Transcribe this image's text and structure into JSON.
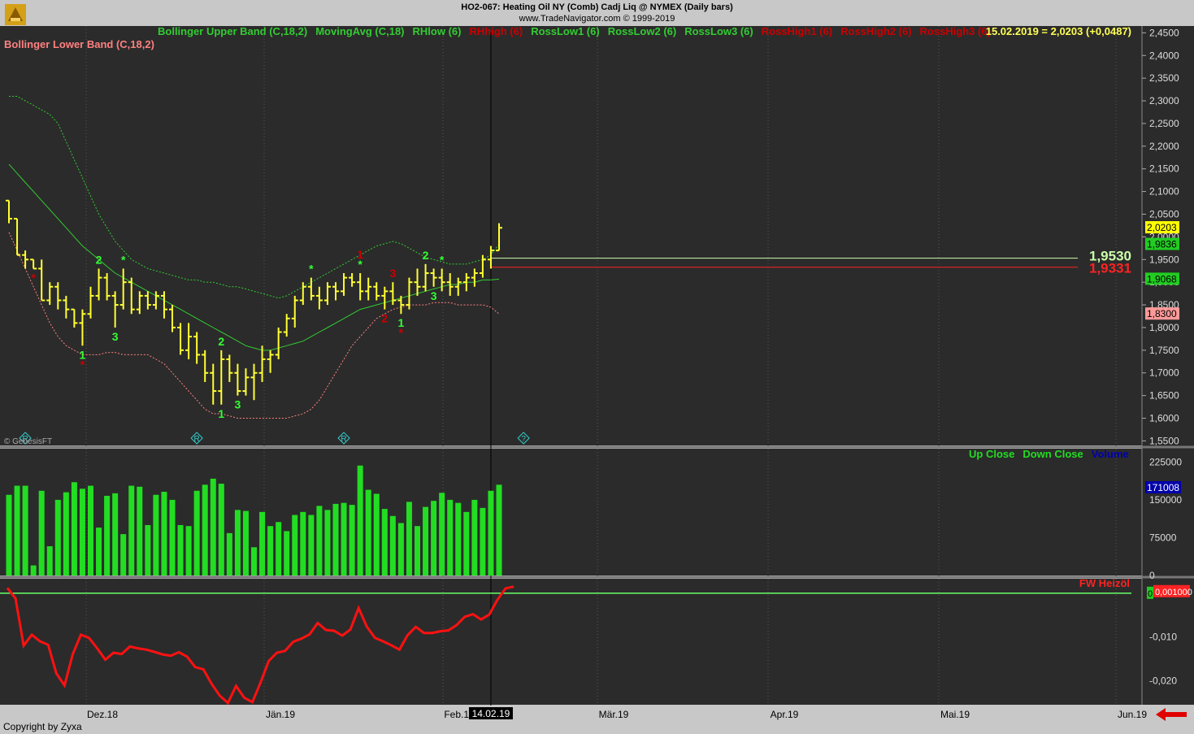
{
  "header": {
    "title": "HO2-067:  Heating Oil NY (Comb) Cadj Liq @ NYMEX  (Daily bars)",
    "subtitle": "www.TradeNavigator.com © 1999-2019"
  },
  "footer": {
    "copyright": "Copyright by Zyxa",
    "genesis": "© GenesisFT"
  },
  "colors": {
    "background": "#2b2b2b",
    "bars": "#ffff33",
    "bands": "#33cc33",
    "lower_band": "#ff8080",
    "volume": "#22dd22",
    "oscillator": "#ff1111",
    "ross_high": "#cc0000",
    "ross_low": "#33ff33"
  },
  "price_panel": {
    "legend": [
      {
        "text": "Bollinger Upper Band (C,18,2)",
        "color": "#33cc33"
      },
      {
        "text": "MovingAvg (C,18)",
        "color": "#33cc33"
      },
      {
        "text": "RHlow (6)",
        "color": "#33cc33"
      },
      {
        "text": "RHhigh (6)",
        "color": "#cc0000"
      },
      {
        "text": "RossLow1 (6)",
        "color": "#33cc33"
      },
      {
        "text": "RossLow2 (6)",
        "color": "#33cc33"
      },
      {
        "text": "RossLow3 (6)",
        "color": "#33cc33"
      },
      {
        "text": "RossHigh1 (6)",
        "color": "#cc0000"
      },
      {
        "text": "RossHigh2 (6)",
        "color": "#cc0000"
      },
      {
        "text": "RossHigh3 (6)",
        "color": "#cc0000"
      }
    ],
    "legend2": {
      "text": "Bollinger Lower Band (C,18,2)",
      "color": "#ff8080"
    },
    "last_quote": "15.02.2019 = 2,0203 (+0,0487)",
    "y_ticks": [
      "2,4500",
      "2,4000",
      "2,3500",
      "2,3000",
      "2,2500",
      "2,2000",
      "2,1500",
      "2,1000",
      "2,0500",
      "2,0000",
      "1,9500",
      "1,9000",
      "1,8500",
      "1,8000",
      "1,7500",
      "1,7000",
      "1,6500",
      "1,6000",
      "1,5500"
    ],
    "level_lines": [
      {
        "label": "1,9530",
        "value": 1.953,
        "color": "#ccffaa"
      },
      {
        "label": "1,9331",
        "value": 1.9331,
        "color": "#ff2222"
      }
    ],
    "value_tags": [
      {
        "label": "2,0203",
        "value": 2.0203,
        "bg": "#ffff00",
        "fg": "#000000"
      },
      {
        "label": "1,9836",
        "value": 1.9836,
        "bg": "#22cc22",
        "fg": "#000000"
      },
      {
        "label": "1,9068",
        "value": 1.9068,
        "bg": "#22cc22",
        "fg": "#000000"
      },
      {
        "label": "1,8300",
        "value": 1.83,
        "bg": "#ff9999",
        "fg": "#000000"
      }
    ],
    "markers": [
      {
        "i": 3,
        "t": "*",
        "c": "r",
        "low": true
      },
      {
        "i": 9,
        "t": "1",
        "c": "g",
        "low": true
      },
      {
        "i": 9,
        "t": "*",
        "c": "r",
        "low": true,
        "off": 1
      },
      {
        "i": 11,
        "t": "2",
        "c": "g",
        "low": false
      },
      {
        "i": 13,
        "t": "3",
        "c": "g",
        "low": true
      },
      {
        "i": 14,
        "t": "*",
        "c": "g",
        "low": false
      },
      {
        "i": 26,
        "t": "2",
        "c": "g",
        "low": false
      },
      {
        "i": 26,
        "t": "1",
        "c": "g",
        "low": true
      },
      {
        "i": 28,
        "t": "3",
        "c": "g",
        "low": true
      },
      {
        "i": 37,
        "t": "*",
        "c": "g",
        "low": false
      },
      {
        "i": 43,
        "t": "*",
        "c": "g",
        "low": false
      },
      {
        "i": 43,
        "t": "1",
        "c": "r",
        "low": false,
        "off": 1
      },
      {
        "i": 46,
        "t": "2",
        "c": "r",
        "low": true
      },
      {
        "i": 47,
        "t": "3",
        "c": "r",
        "low": false
      },
      {
        "i": 48,
        "t": "1",
        "c": "g",
        "low": true
      },
      {
        "i": 48,
        "t": "*",
        "c": "r",
        "low": true,
        "off": 1
      },
      {
        "i": 51,
        "t": "2",
        "c": "g",
        "low": false
      },
      {
        "i": 52,
        "t": "3",
        "c": "g",
        "low": true
      },
      {
        "i": 53,
        "t": "*",
        "c": "g",
        "low": false
      }
    ],
    "events": [
      "R",
      "R",
      "R",
      "?"
    ],
    "event_idx": [
      2,
      23,
      41,
      63
    ]
  },
  "volume_panel": {
    "legend": [
      {
        "text": "Up Close",
        "color": "#22dd22"
      },
      {
        "text": "Down Close",
        "color": "#22dd22"
      },
      {
        "text": "Volume",
        "color": "#0000aa"
      }
    ],
    "y_ticks": [
      "225000",
      "150000",
      "75000",
      "0"
    ],
    "tag": "171008"
  },
  "osc_panel": {
    "legend": "FW Heizöl",
    "y_ticks": [
      "-0,010",
      "-0,020"
    ],
    "tag": "0,001000",
    "zero_label": "0"
  },
  "x_axis": {
    "labels": [
      "Dez.18",
      "Jän.19",
      "Feb.19",
      "Mär.19",
      "Apr.19",
      "Mai.19",
      "Jun.19"
    ],
    "cursor_label": "14.02.19"
  },
  "chart_data": {
    "type": "ohlc",
    "dates": [
      "2018-11-19",
      "2018-11-20",
      "2018-11-21",
      "2018-11-23",
      "2018-11-26",
      "2018-11-27",
      "2018-11-28",
      "2018-11-29",
      "2018-11-30",
      "2018-12-03",
      "2018-12-04",
      "2018-12-05",
      "2018-12-06",
      "2018-12-07",
      "2018-12-10",
      "2018-12-11",
      "2018-12-12",
      "2018-12-13",
      "2018-12-14",
      "2018-12-17",
      "2018-12-18",
      "2018-12-19",
      "2018-12-20",
      "2018-12-21",
      "2018-12-24",
      "2018-12-26",
      "2018-12-27",
      "2018-12-28",
      "2018-12-31",
      "2019-01-02",
      "2019-01-03",
      "2019-01-04",
      "2019-01-07",
      "2019-01-08",
      "2019-01-09",
      "2019-01-10",
      "2019-01-11",
      "2019-01-14",
      "2019-01-15",
      "2019-01-16",
      "2019-01-17",
      "2019-01-18",
      "2019-01-22",
      "2019-01-23",
      "2019-01-24",
      "2019-01-25",
      "2019-01-28",
      "2019-01-29",
      "2019-01-30",
      "2019-01-31",
      "2019-02-01",
      "2019-02-04",
      "2019-02-05",
      "2019-02-06",
      "2019-02-07",
      "2019-02-08",
      "2019-02-11",
      "2019-02-12",
      "2019-02-13",
      "2019-02-14",
      "2019-02-15"
    ],
    "ohlc": [
      [
        2.08,
        2.08,
        2.03,
        2.04
      ],
      [
        2.04,
        2.04,
        1.96,
        1.96
      ],
      [
        1.96,
        1.97,
        1.93,
        1.95
      ],
      [
        1.95,
        1.95,
        1.93,
        1.93
      ],
      [
        1.93,
        1.95,
        1.86,
        1.86
      ],
      [
        1.86,
        1.9,
        1.85,
        1.89
      ],
      [
        1.89,
        1.9,
        1.84,
        1.86
      ],
      [
        1.86,
        1.87,
        1.82,
        1.84
      ],
      [
        1.84,
        1.84,
        1.8,
        1.81
      ],
      [
        1.81,
        1.84,
        1.76,
        1.83
      ],
      [
        1.83,
        1.89,
        1.82,
        1.87
      ],
      [
        1.87,
        1.93,
        1.86,
        1.91
      ],
      [
        1.91,
        1.92,
        1.86,
        1.87
      ],
      [
        1.87,
        1.88,
        1.8,
        1.85
      ],
      [
        1.85,
        1.93,
        1.84,
        1.9
      ],
      [
        1.9,
        1.91,
        1.83,
        1.84
      ],
      [
        1.84,
        1.88,
        1.83,
        1.87
      ],
      [
        1.87,
        1.88,
        1.84,
        1.85
      ],
      [
        1.85,
        1.88,
        1.84,
        1.87
      ],
      [
        1.87,
        1.88,
        1.82,
        1.84
      ],
      [
        1.84,
        1.85,
        1.79,
        1.8
      ],
      [
        1.8,
        1.81,
        1.74,
        1.75
      ],
      [
        1.75,
        1.81,
        1.73,
        1.78
      ],
      [
        1.78,
        1.79,
        1.72,
        1.74
      ],
      [
        1.74,
        1.75,
        1.68,
        1.7
      ],
      [
        1.7,
        1.72,
        1.63,
        1.66
      ],
      [
        1.66,
        1.75,
        1.63,
        1.73
      ],
      [
        1.73,
        1.74,
        1.68,
        1.7
      ],
      [
        1.7,
        1.72,
        1.65,
        1.66
      ],
      [
        1.66,
        1.71,
        1.65,
        1.69
      ],
      [
        1.69,
        1.72,
        1.64,
        1.7
      ],
      [
        1.7,
        1.76,
        1.68,
        1.73
      ],
      [
        1.73,
        1.75,
        1.7,
        1.74
      ],
      [
        1.74,
        1.8,
        1.73,
        1.79
      ],
      [
        1.79,
        1.83,
        1.78,
        1.82
      ],
      [
        1.82,
        1.87,
        1.8,
        1.86
      ],
      [
        1.86,
        1.9,
        1.85,
        1.89
      ],
      [
        1.89,
        1.91,
        1.86,
        1.87
      ],
      [
        1.87,
        1.89,
        1.84,
        1.86
      ],
      [
        1.86,
        1.9,
        1.85,
        1.89
      ],
      [
        1.89,
        1.9,
        1.86,
        1.88
      ],
      [
        1.88,
        1.92,
        1.87,
        1.91
      ],
      [
        1.91,
        1.92,
        1.89,
        1.9
      ],
      [
        1.9,
        1.92,
        1.86,
        1.88
      ],
      [
        1.88,
        1.91,
        1.86,
        1.89
      ],
      [
        1.89,
        1.9,
        1.86,
        1.87
      ],
      [
        1.87,
        1.89,
        1.84,
        1.88
      ],
      [
        1.88,
        1.9,
        1.85,
        1.86
      ],
      [
        1.86,
        1.87,
        1.83,
        1.85
      ],
      [
        1.85,
        1.91,
        1.84,
        1.9
      ],
      [
        1.9,
        1.93,
        1.87,
        1.89
      ],
      [
        1.89,
        1.94,
        1.88,
        1.92
      ],
      [
        1.92,
        1.93,
        1.89,
        1.91
      ],
      [
        1.91,
        1.93,
        1.88,
        1.9
      ],
      [
        1.9,
        1.92,
        1.87,
        1.89
      ],
      [
        1.89,
        1.91,
        1.87,
        1.9
      ],
      [
        1.9,
        1.92,
        1.88,
        1.91
      ],
      [
        1.91,
        1.93,
        1.89,
        1.92
      ],
      [
        1.92,
        1.96,
        1.91,
        1.95
      ],
      [
        1.95,
        1.98,
        1.93,
        1.97
      ],
      [
        1.97,
        2.03,
        1.97,
        2.02
      ]
    ],
    "ma": [
      2.16,
      2.14,
      2.12,
      2.1,
      2.08,
      2.06,
      2.04,
      2.02,
      2.0,
      1.98,
      1.965,
      1.95,
      1.935,
      1.92,
      1.91,
      1.9,
      1.89,
      1.88,
      1.87,
      1.86,
      1.85,
      1.84,
      1.83,
      1.82,
      1.81,
      1.8,
      1.79,
      1.78,
      1.77,
      1.76,
      1.755,
      1.75,
      1.75,
      1.755,
      1.76,
      1.765,
      1.77,
      1.78,
      1.79,
      1.8,
      1.81,
      1.82,
      1.83,
      1.84,
      1.845,
      1.85,
      1.855,
      1.86,
      1.865,
      1.87,
      1.875,
      1.88,
      1.885,
      1.89,
      1.895,
      1.895,
      1.9,
      1.9,
      1.905,
      1.905,
      1.9068
    ],
    "upper": [
      2.31,
      2.31,
      2.3,
      2.29,
      2.28,
      2.27,
      2.25,
      2.21,
      2.17,
      2.13,
      2.09,
      2.05,
      2.02,
      1.99,
      1.97,
      1.95,
      1.94,
      1.93,
      1.925,
      1.92,
      1.915,
      1.91,
      1.905,
      1.905,
      1.9,
      1.9,
      1.895,
      1.89,
      1.89,
      1.885,
      1.88,
      1.875,
      1.87,
      1.865,
      1.87,
      1.88,
      1.89,
      1.9,
      1.91,
      1.92,
      1.93,
      1.94,
      1.95,
      1.96,
      1.97,
      1.98,
      1.985,
      1.99,
      1.985,
      1.975,
      1.965,
      1.955,
      1.95,
      1.945,
      1.94,
      1.94,
      1.94,
      1.945,
      1.95,
      1.96,
      1.9836
    ],
    "lower": [
      2.01,
      1.97,
      1.93,
      1.89,
      1.85,
      1.81,
      1.78,
      1.76,
      1.75,
      1.74,
      1.74,
      1.74,
      1.745,
      1.745,
      1.74,
      1.74,
      1.74,
      1.74,
      1.73,
      1.72,
      1.7,
      1.68,
      1.66,
      1.64,
      1.62,
      1.61,
      1.61,
      1.605,
      1.6,
      1.6,
      1.6,
      1.6,
      1.6,
      1.6,
      1.6,
      1.605,
      1.61,
      1.62,
      1.64,
      1.67,
      1.7,
      1.73,
      1.76,
      1.78,
      1.8,
      1.82,
      1.83,
      1.84,
      1.845,
      1.85,
      1.85,
      1.85,
      1.855,
      1.855,
      1.855,
      1.85,
      1.85,
      1.85,
      1.85,
      1.845,
      1.83
    ],
    "volume": [
      160,
      178,
      178,
      20,
      168,
      58,
      150,
      165,
      185,
      172,
      178,
      95,
      158,
      163,
      82,
      178,
      176,
      100,
      160,
      166,
      150,
      100,
      98,
      168,
      180,
      192,
      182,
      84,
      130,
      128,
      56,
      126,
      98,
      106,
      88,
      120,
      126,
      120,
      138,
      130,
      142,
      144,
      140,
      218,
      170,
      162,
      132,
      118,
      104,
      146,
      98,
      136,
      148,
      164,
      150,
      144,
      126,
      150,
      134,
      168,
      180
    ],
    "oscillator": [
      0.0012,
      -0.0012,
      -0.012,
      -0.0095,
      -0.011,
      -0.0118,
      -0.0183,
      -0.0211,
      -0.014,
      -0.0095,
      -0.0102,
      -0.0126,
      -0.0152,
      -0.0136,
      -0.0139,
      -0.0122,
      -0.0126,
      -0.0129,
      -0.0134,
      -0.014,
      -0.0143,
      -0.0135,
      -0.0145,
      -0.0169,
      -0.0174,
      -0.0207,
      -0.0234,
      -0.0251,
      -0.0212,
      -0.0239,
      -0.0249,
      -0.0204,
      -0.0155,
      -0.0136,
      -0.0132,
      -0.0111,
      -0.0104,
      -0.0094,
      -0.0068,
      -0.0084,
      -0.0086,
      -0.0097,
      -0.0083,
      -0.0034,
      -0.0076,
      -0.0102,
      -0.011,
      -0.0119,
      -0.0129,
      -0.0096,
      -0.0077,
      -0.0091,
      -0.0091,
      -0.0087,
      -0.0085,
      -0.0073,
      -0.0054,
      -0.0048,
      -0.006,
      -0.0049,
      -0.0015,
      0.0011,
      0.0015
    ],
    "price_ylim": [
      1.54,
      2.465
    ],
    "volume_ylim": [
      0,
      245000
    ],
    "osc_ylim": [
      -0.0255,
      0.0033
    ],
    "legend": "top"
  }
}
